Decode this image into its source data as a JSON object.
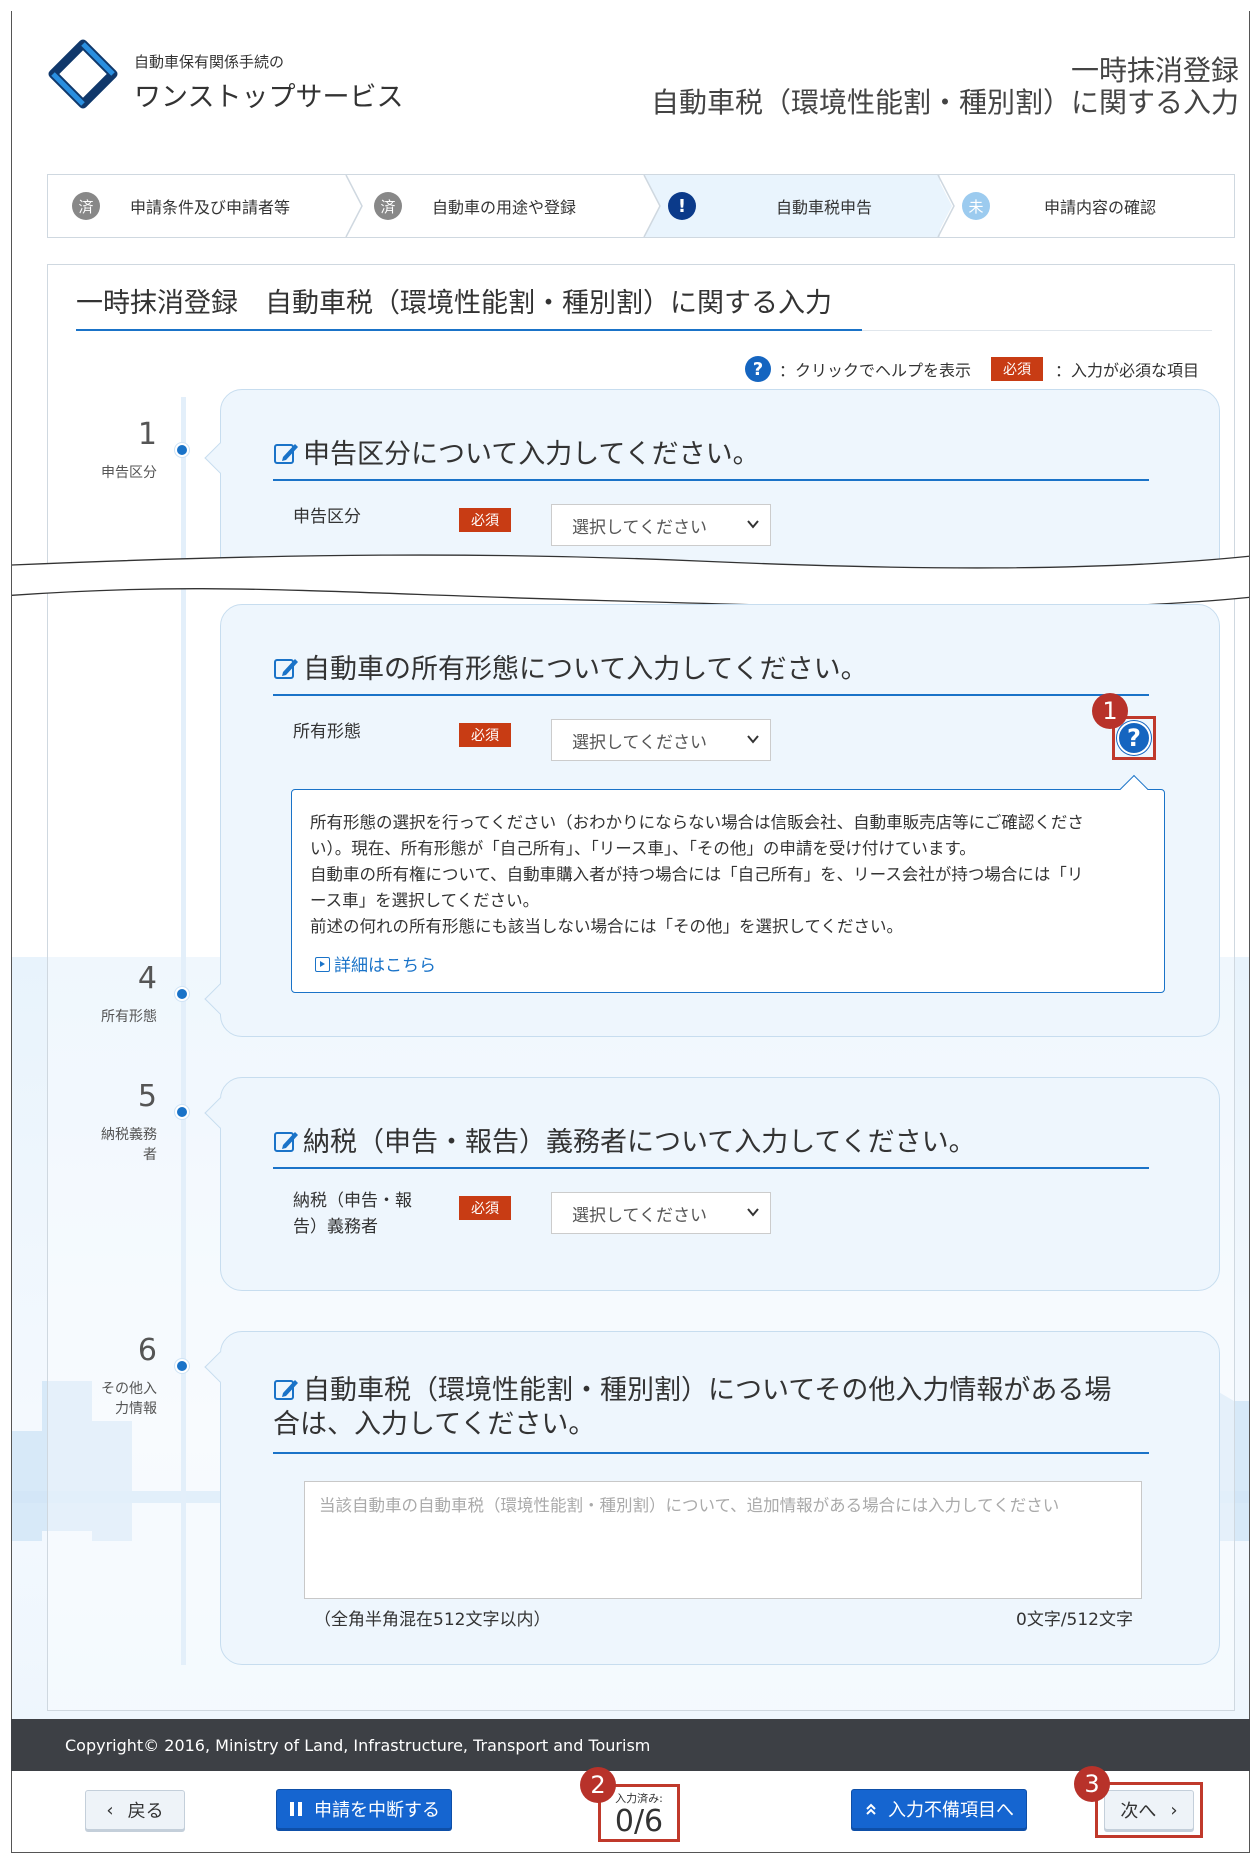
{
  "header": {
    "logo_small": "自動車保有関係手続の",
    "logo_big": "ワンストップサービス",
    "page_title_line1": "一時抹消登録",
    "page_title_line2": "自動車税（環境性能割・種別割）に関する入力"
  },
  "steps": [
    {
      "badge": "済",
      "label": "申請条件及び申請者等",
      "state": "done"
    },
    {
      "badge": "済",
      "label": "自動車の用途や登録",
      "state": "done"
    },
    {
      "badge": "!",
      "label": "自動車税申告",
      "state": "current"
    },
    {
      "badge": "未",
      "label": "申請内容の確認",
      "state": "todo"
    }
  ],
  "main": {
    "title": "一時抹消登録　自動車税（環境性能割・種別割）に関する入力",
    "legend_help_icon": "?",
    "legend_help": "：クリックでヘルプを表示",
    "legend_required_badge": "必須",
    "legend_required": "：入力が必須な項目"
  },
  "sections": {
    "s1": {
      "number": "1",
      "side_label": "申告区分",
      "title": "申告区分について入力してください。",
      "field_label": "申告区分",
      "required": "必須",
      "select_value": "選択してください"
    },
    "s4": {
      "number": "4",
      "side_label": "所有形態",
      "title": "自動車の所有形態について入力してください。",
      "field_label": "所有形態",
      "required": "必須",
      "select_value": "選択してください",
      "help_icon": "?"
    },
    "s5": {
      "number": "5",
      "side_label_1": "納税義務",
      "side_label_2": "者",
      "title": "納税（申告・報告）義務者について入力してください。",
      "field_label_1": "納税（申告・報",
      "field_label_2": "告）義務者",
      "required": "必須",
      "select_value": "選択してください"
    },
    "s6": {
      "number": "6",
      "side_label_1": "その他入",
      "side_label_2": "力情報",
      "title_1": "自動車税（環境性能割・種別割）についてその他入力情報がある場",
      "title_2": "合は、入力してください。",
      "textarea_placeholder": "当該自動車の自動車税（環境性能割・種別割）について、追加情報がある場合には入力してください",
      "note_left": "（全角半角混在512文字以内）",
      "note_right": "0文字/512文字"
    }
  },
  "help_box": {
    "line1": "所有形態の選択を行ってください（おわかりにならない場合は信販会社、自動車販売店等にご確認くださ",
    "line2": "い）。現在、所有形態が「自己所有」、「リース車」、「その他」の申請を受け付けています。",
    "line3": "自動車の所有権について、自動車購入者が持つ場合には「自己所有」を、リース会社が持つ場合には「リ",
    "line4": "ース車」を選択してください。",
    "line5": "前述の何れの所有形態にも該当しない場合には「その他」を選択してください。",
    "link": "詳細はこちら"
  },
  "callouts": [
    "1",
    "2",
    "3"
  ],
  "footer": {
    "copyright": "Copyright© 2016, Ministry of Land, Infrastructure, Transport and Tourism",
    "back": "戻る",
    "back_icon": "‹",
    "suspend": "申請を中断する",
    "progress_label": "入力済み:",
    "progress_value": "0/6",
    "incomplete": "入力不備項目へ",
    "next": "次へ",
    "next_icon": "›"
  },
  "colors": {
    "accent": "#1a73c8",
    "required": "#c83c14",
    "callout": "#b8322a",
    "footer_bar": "#3d4045"
  }
}
